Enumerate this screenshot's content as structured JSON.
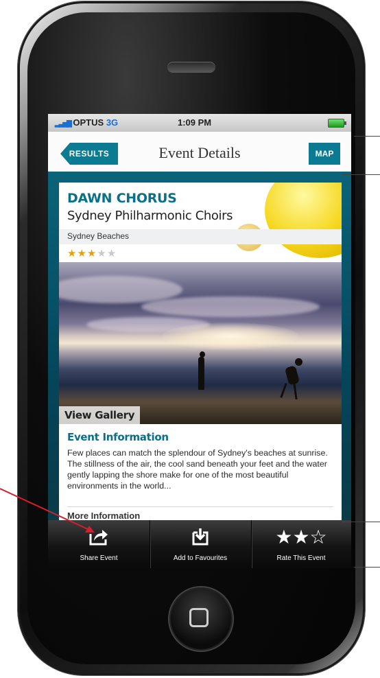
{
  "status_bar": {
    "carrier": "OPTUS",
    "network": "3G",
    "time": "1:09 PM"
  },
  "nav_bar": {
    "back_label": "RESULTS",
    "title": "Event Details",
    "map_label": "MAP"
  },
  "event": {
    "title": "DAWN CHORUS",
    "subtitle": "Sydney Philharmonic Choirs",
    "venue": "Sydney Beaches",
    "rating": 3,
    "rating_max": 5,
    "gallery_label": "View Gallery",
    "info_heading": "Event Information",
    "info_text": "Few places can match the splendour of Sydney's beaches at sunrise. The stillness of the air, the cool sand beneath your feet and the water gently lapping the shore make for one of the most beautiful environments in the world...",
    "more_info_label": "More Information"
  },
  "tab_bar": [
    {
      "label": "Share Event",
      "icon": "share-icon"
    },
    {
      "label": "Add to Favourites",
      "icon": "add-favourite-icon"
    },
    {
      "label": "Rate This Event",
      "icon": "stars-rating-icon",
      "rating": 2,
      "rating_max": 3
    }
  ],
  "colors": {
    "accent": "#0a7b93",
    "title_blue": "#0a6f88",
    "star": "#e8a200",
    "annotation_arrow": "#d41f2b"
  }
}
